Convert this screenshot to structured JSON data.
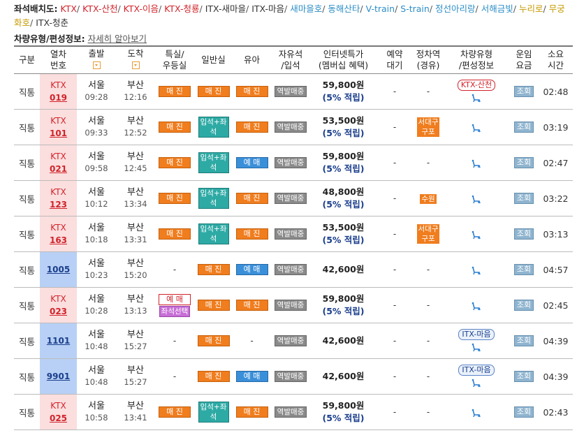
{
  "legend": {
    "label": "좌석배치도:",
    "items": [
      {
        "text": "KTX",
        "color": "#d1232a"
      },
      {
        "text": "KTX-산천",
        "color": "#d1232a"
      },
      {
        "text": "KTX-이음",
        "color": "#d1232a"
      },
      {
        "text": "KTX-청룡",
        "color": "#d1232a"
      },
      {
        "text": "ITX-새마을",
        "color": "#333333"
      },
      {
        "text": "ITX-마음",
        "color": "#333333"
      },
      {
        "text": "새마을호",
        "color": "#2c8ec7"
      },
      {
        "text": "동해산타",
        "color": "#2c8ec7"
      },
      {
        "text": "V-train",
        "color": "#2c8ec7"
      },
      {
        "text": "S-train",
        "color": "#2c8ec7"
      },
      {
        "text": "정선아리랑",
        "color": "#2c8ec7"
      },
      {
        "text": "서해금빛",
        "color": "#2c8ec7"
      },
      {
        "text": "누리로",
        "color": "#c79a00"
      },
      {
        "text": "무궁화호",
        "color": "#c79a00"
      },
      {
        "text": "ITX-청춘",
        "color": "#333333"
      }
    ]
  },
  "info": {
    "label": "차량유형/편성정보:",
    "link": "자세히 알아보기"
  },
  "headers": {
    "type": "구분",
    "train1": "열차",
    "train2": "번호",
    "dep": "출발",
    "arr": "도착",
    "sp1": "특실/",
    "sp2": "우등실",
    "gen": "일반실",
    "baby": "유아",
    "free1": "자유석",
    "free2": "/입석",
    "price1": "인터넷특가",
    "price2": "(멤버십 혜택)",
    "wait1": "예약",
    "wait2": "대기",
    "via1": "정차역",
    "via2": "(경유)",
    "veh1": "차량유형",
    "veh2": "/편성정보",
    "fare1": "운임",
    "fare2": "요금",
    "dur1": "소요",
    "dur2": "시간"
  },
  "rows": [
    {
      "type": "직통",
      "t1": "KTX",
      "t2": "019",
      "ktx": true,
      "dep": "서울",
      "dep_time": "09:28",
      "arr": "부산",
      "arr_time": "12:16",
      "special": "매 진",
      "general": "매 진",
      "general_kind": "sold",
      "baby": "매 진",
      "baby_kind": "sold",
      "free": "역발매중",
      "price": "59,800원",
      "point": "(5% 적립)",
      "wait": "-",
      "via": "-",
      "vehicle": "KTX-산천",
      "vehicle_kind": "ktx",
      "fare": "조회",
      "duration": "02:48"
    },
    {
      "type": "직통",
      "t1": "KTX",
      "t2": "101",
      "ktx": true,
      "dep": "서울",
      "dep_time": "09:33",
      "arr": "부산",
      "arr_time": "12:52",
      "special": "매 진",
      "general": "입석+좌석",
      "general_kind": "std",
      "baby": "매 진",
      "baby_kind": "sold",
      "free": "역발매중",
      "price": "53,500원",
      "point": "(5% 적립)",
      "wait": "-",
      "via": "서대구 구포",
      "vehicle": "",
      "vehicle_kind": "",
      "fare": "조회",
      "duration": "03:19"
    },
    {
      "type": "직통",
      "t1": "KTX",
      "t2": "021",
      "ktx": true,
      "dep": "서울",
      "dep_time": "09:58",
      "arr": "부산",
      "arr_time": "12:45",
      "special": "매 진",
      "general": "입석+좌석",
      "general_kind": "std",
      "baby": "예 매",
      "baby_kind": "resv",
      "free": "역발매중",
      "price": "59,800원",
      "point": "(5% 적립)",
      "wait": "-",
      "via": "-",
      "vehicle": "",
      "vehicle_kind": "",
      "fare": "조회",
      "duration": "02:47"
    },
    {
      "type": "직통",
      "t1": "KTX",
      "t2": "123",
      "ktx": true,
      "dep": "서울",
      "dep_time": "10:12",
      "arr": "부산",
      "arr_time": "13:34",
      "special": "매 진",
      "general": "입석+좌석",
      "general_kind": "std",
      "baby": "매 진",
      "baby_kind": "sold",
      "free": "역발매중",
      "price": "48,800원",
      "point": "(5% 적립)",
      "wait": "-",
      "via": "수원",
      "vehicle": "",
      "vehicle_kind": "",
      "fare": "조회",
      "duration": "03:22"
    },
    {
      "type": "직통",
      "t1": "KTX",
      "t2": "163",
      "ktx": true,
      "dep": "서울",
      "dep_time": "10:18",
      "arr": "부산",
      "arr_time": "13:31",
      "special": "매 진",
      "general": "입석+좌석",
      "general_kind": "std",
      "baby": "매 진",
      "baby_kind": "sold",
      "free": "역발매중",
      "price": "53,500원",
      "point": "(5% 적립)",
      "wait": "-",
      "via": "서대구 구포",
      "vehicle": "",
      "vehicle_kind": "",
      "fare": "조회",
      "duration": "03:13"
    },
    {
      "type": "직통",
      "t1": "",
      "t2": "1005",
      "ktx": false,
      "dep": "서울",
      "dep_time": "10:23",
      "arr": "부산",
      "arr_time": "15:20",
      "special": "-",
      "general": "매 진",
      "general_kind": "sold",
      "baby": "예 매",
      "baby_kind": "resv",
      "free": "역발매중",
      "price": "42,600원",
      "point": "",
      "wait": "-",
      "via": "-",
      "vehicle": "",
      "vehicle_kind": "",
      "fare": "조회",
      "duration": "04:57"
    },
    {
      "type": "직통",
      "t1": "KTX",
      "t2": "023",
      "ktx": true,
      "dep": "서울",
      "dep_time": "10:28",
      "arr": "부산",
      "arr_time": "13:13",
      "special": "예 매",
      "special_extra": "좌석선택",
      "general": "매 진",
      "general_kind": "sold",
      "baby": "매 진",
      "baby_kind": "sold",
      "free": "역발매중",
      "price": "59,800원",
      "point": "(5% 적립)",
      "wait": "-",
      "via": "-",
      "vehicle": "",
      "vehicle_kind": "",
      "fare": "조회",
      "duration": "02:45"
    },
    {
      "type": "직통",
      "t1": "",
      "t2": "1101",
      "ktx": false,
      "dep": "서울",
      "dep_time": "10:48",
      "arr": "부산",
      "arr_time": "15:27",
      "special": "-",
      "general": "매 진",
      "general_kind": "sold",
      "baby": "-",
      "baby_kind": "none",
      "free": "역발매중",
      "price": "42,600원",
      "point": "",
      "wait": "-",
      "via": "-",
      "vehicle": "ITX-마음",
      "vehicle_kind": "itx",
      "fare": "조회",
      "duration": "04:39"
    },
    {
      "type": "직통",
      "t1": "",
      "t2": "9901",
      "ktx": false,
      "dep": "서울",
      "dep_time": "10:48",
      "arr": "부산",
      "arr_time": "15:27",
      "special": "-",
      "general": "매 진",
      "general_kind": "sold",
      "baby": "예 매",
      "baby_kind": "resv",
      "free": "역발매중",
      "price": "42,600원",
      "point": "",
      "wait": "-",
      "via": "-",
      "vehicle": "ITX-마음",
      "vehicle_kind": "itx",
      "fare": "조회",
      "duration": "04:39"
    },
    {
      "type": "직통",
      "t1": "KTX",
      "t2": "025",
      "ktx": true,
      "dep": "서울",
      "dep_time": "10:58",
      "arr": "부산",
      "arr_time": "13:41",
      "special": "매 진",
      "general": "입석+좌석",
      "general_kind": "std",
      "baby": "매 진",
      "baby_kind": "sold",
      "free": "역발매중",
      "price": "59,800원",
      "point": "(5% 적립)",
      "wait": "-",
      "via": "-",
      "vehicle": "",
      "vehicle_kind": "",
      "fare": "조회",
      "duration": "02:43"
    }
  ]
}
